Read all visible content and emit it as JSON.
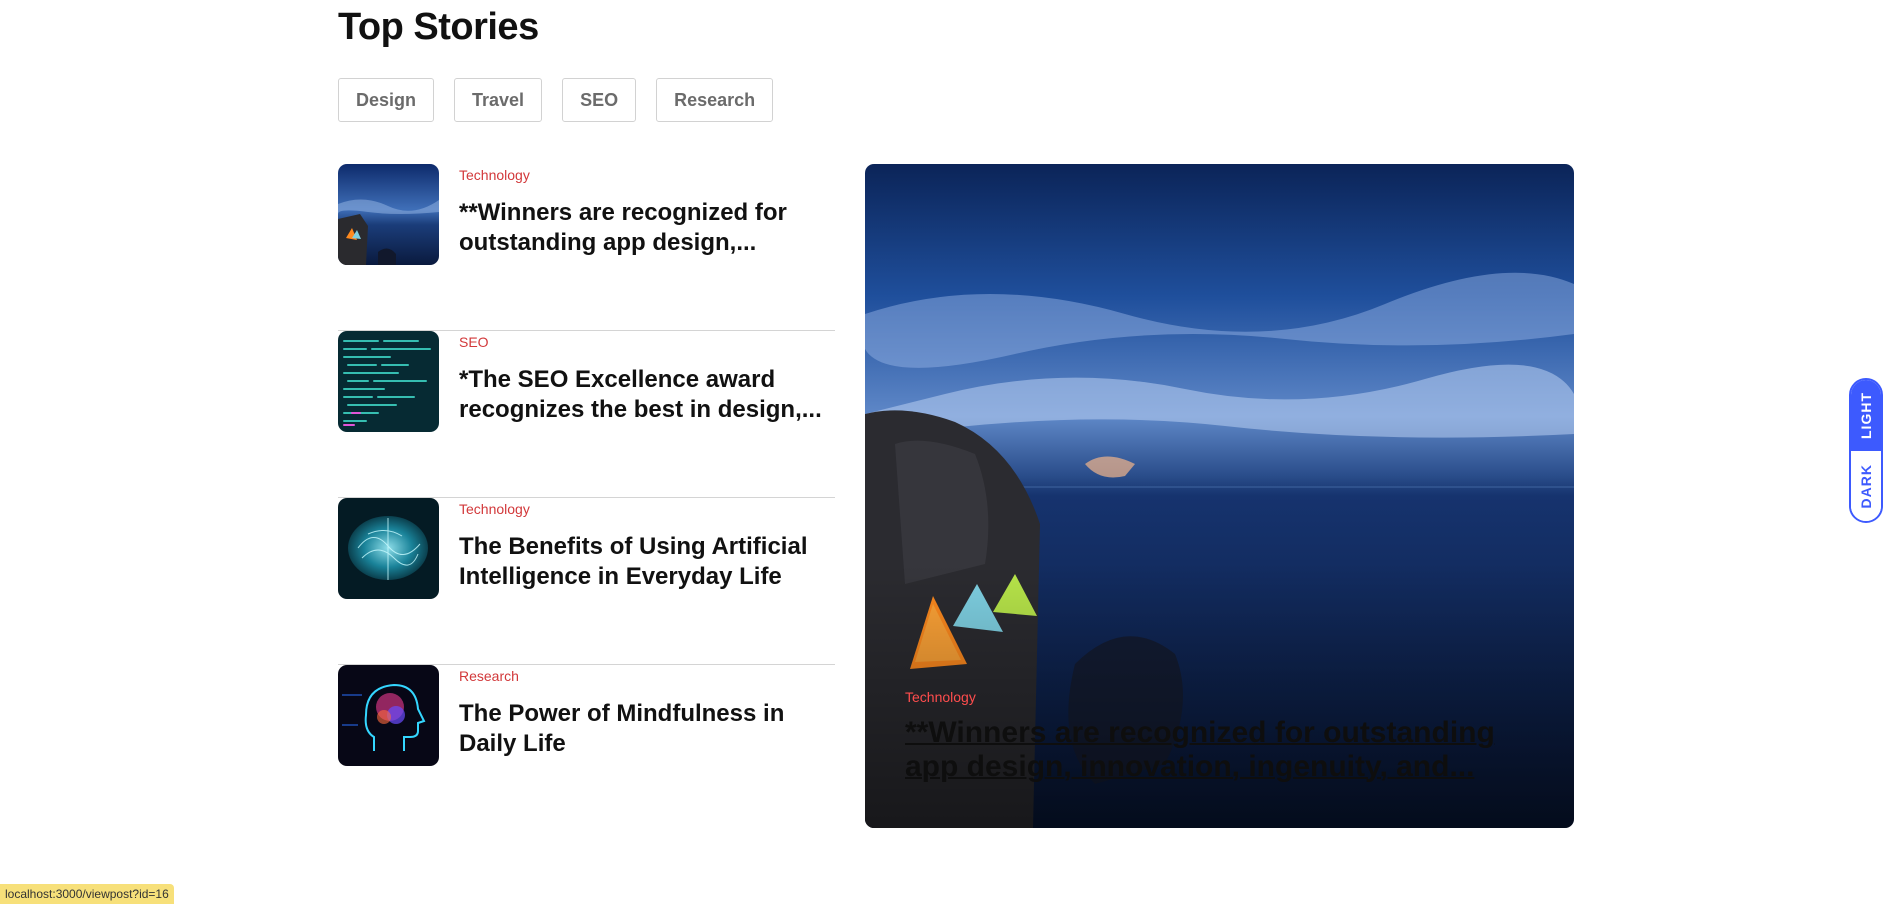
{
  "section": {
    "title": "Top Stories"
  },
  "chips": [
    "Design",
    "Travel",
    "SEO",
    "Research"
  ],
  "stories": [
    {
      "category": "Technology",
      "title": "**Winners are recognized for outstanding app design,...",
      "image": "cliff-tents-night"
    },
    {
      "category": "SEO",
      "title": "*The SEO Excellence award recognizes the best in design,...",
      "image": "code-screen"
    },
    {
      "category": "Technology",
      "title": "The Benefits of Using Artificial Intelligence in Everyday Life",
      "image": "digital-brain"
    },
    {
      "category": "Research",
      "title": "The Power of Mindfulness in Daily Life",
      "image": "neon-head-profile"
    }
  ],
  "featured": {
    "category": "Technology",
    "title": "**Winners are recognized for outstanding app design, innovation, ingenuity, and...",
    "image": "cliff-tents-night"
  },
  "theme_toggle": {
    "light_label": "LIGHT",
    "dark_label": "DARK",
    "active": "light"
  },
  "status_bar": {
    "url": "localhost:3000/viewpost?id=16"
  },
  "colors": {
    "accent": "#3d5afe",
    "category": "#d2383a",
    "status_bg": "#f7e07a"
  }
}
